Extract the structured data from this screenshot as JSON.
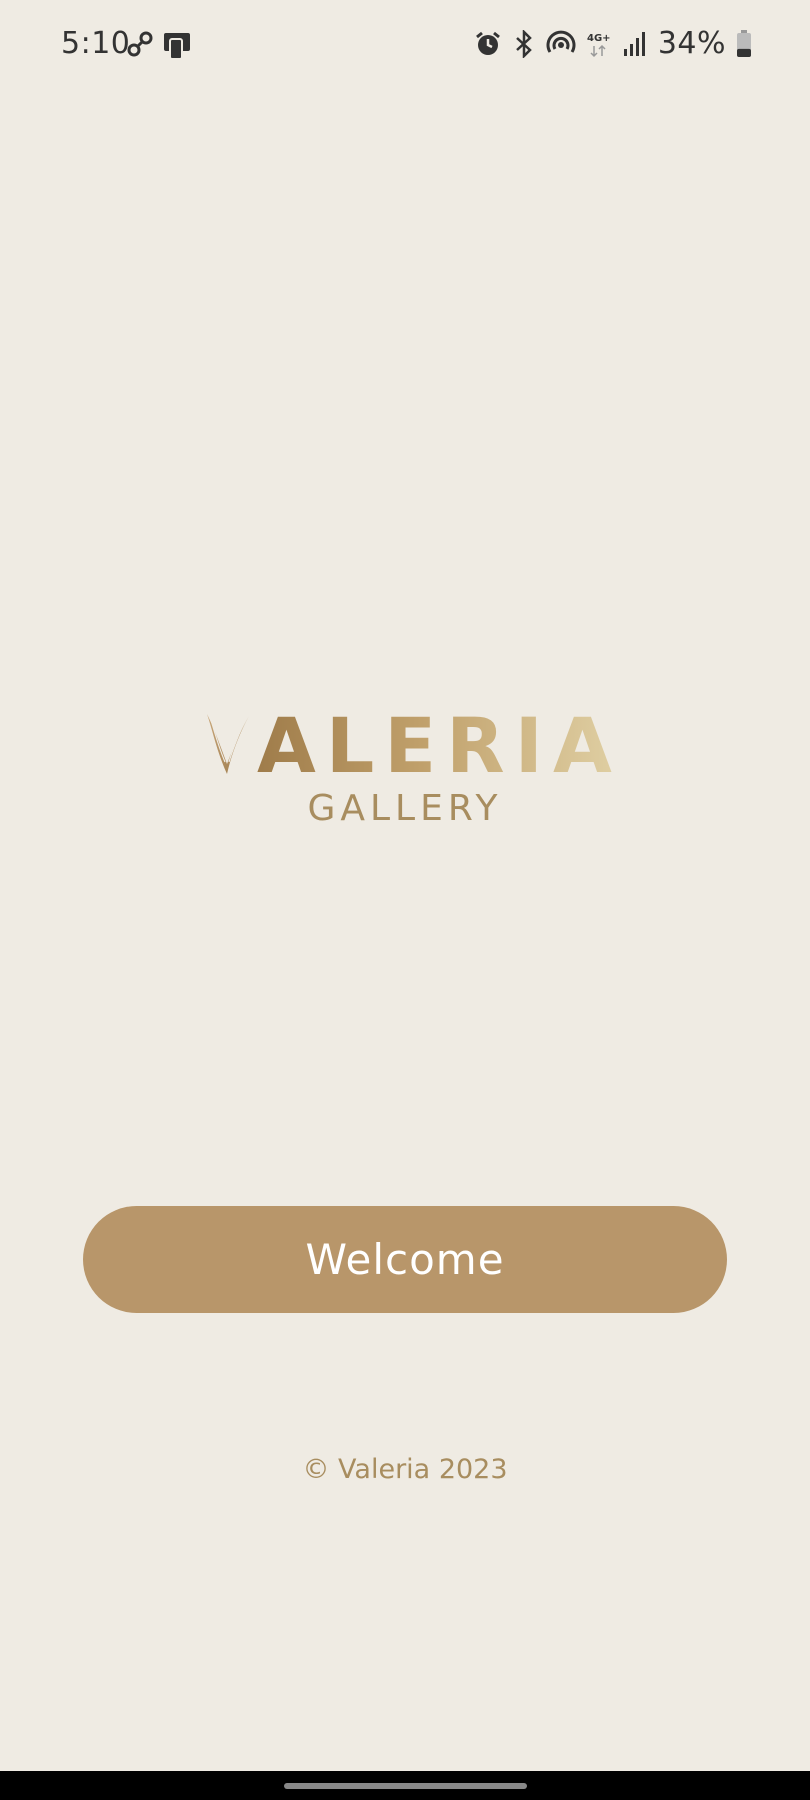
{
  "status_bar": {
    "time": "5:10",
    "battery_percent": "34%",
    "network_type": "4G+",
    "icons": [
      "link-icon",
      "screen-mirror-icon",
      "alarm-icon",
      "bluetooth-icon",
      "hotspot-icon",
      "network-4g-icon",
      "signal-icon",
      "battery-icon"
    ],
    "battery_level": 0.34
  },
  "logo": {
    "wordmark": "ALERIA",
    "subtitle": "GALLERY"
  },
  "welcome_button": {
    "label": "Welcome"
  },
  "footer": {
    "copyright": "© Valeria 2023"
  },
  "colors": {
    "background": "#efebe3",
    "accent": "#b8966a",
    "text_gold": "#a88d5f"
  }
}
